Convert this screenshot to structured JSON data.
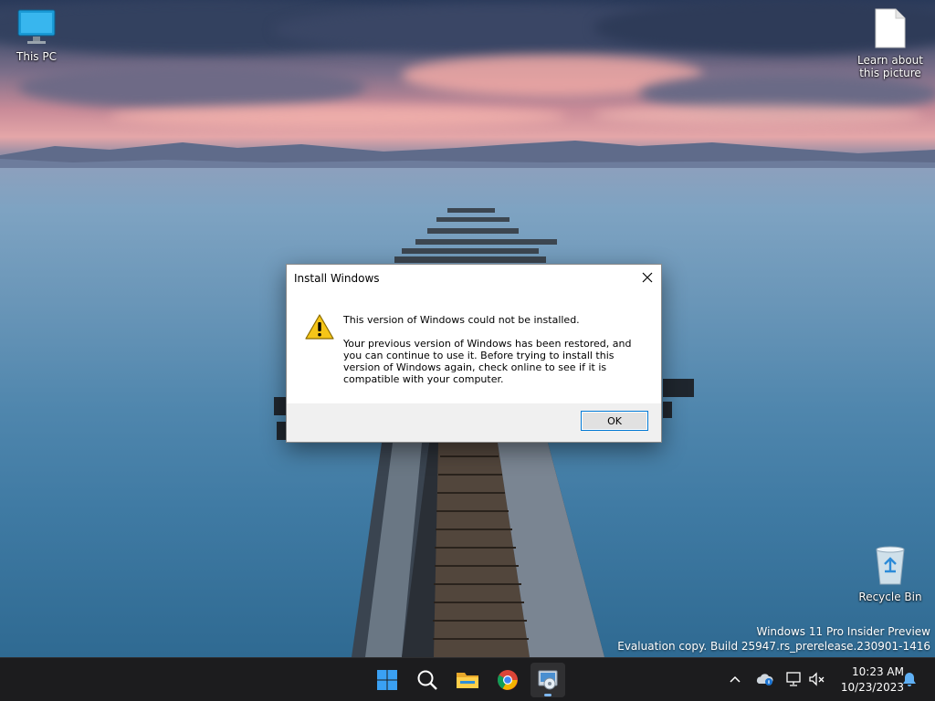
{
  "desktop": {
    "icons": [
      {
        "label": "This PC",
        "icon": "monitor-icon"
      },
      {
        "label": "Learn about this picture",
        "icon": "document-icon"
      },
      {
        "label": "Recycle Bin",
        "icon": "recycle-bin-icon"
      }
    ],
    "watermark": {
      "line1": "Windows 11 Pro Insider Preview",
      "line2": "Evaluation copy. Build 25947.rs_prerelease.230901-1416"
    }
  },
  "dialog": {
    "title": "Install Windows",
    "heading": "This version of Windows could not be installed.",
    "message": "Your previous version of Windows has been restored, and you can continue to use it.  Before trying to install this version of Windows again, check online to see if it is compatible with your computer.",
    "ok_label": "OK",
    "icon": "warning-icon"
  },
  "taskbar": {
    "apps": [
      {
        "name": "Start",
        "icon": "windows-start-icon"
      },
      {
        "name": "Search",
        "icon": "search-icon"
      },
      {
        "name": "File Explorer",
        "icon": "folder-icon"
      },
      {
        "name": "Google Chrome",
        "icon": "chrome-icon"
      },
      {
        "name": "Windows Setup",
        "icon": "setup-icon",
        "active": true
      }
    ],
    "tray": {
      "icons": [
        "chevron-up-icon",
        "onedrive-icon",
        "network-icon",
        "volume-muted-icon",
        "notification-bell-icon"
      ],
      "time": "10:23 AM",
      "date": "10/23/2023"
    },
    "accent_color": "#0078d4"
  }
}
